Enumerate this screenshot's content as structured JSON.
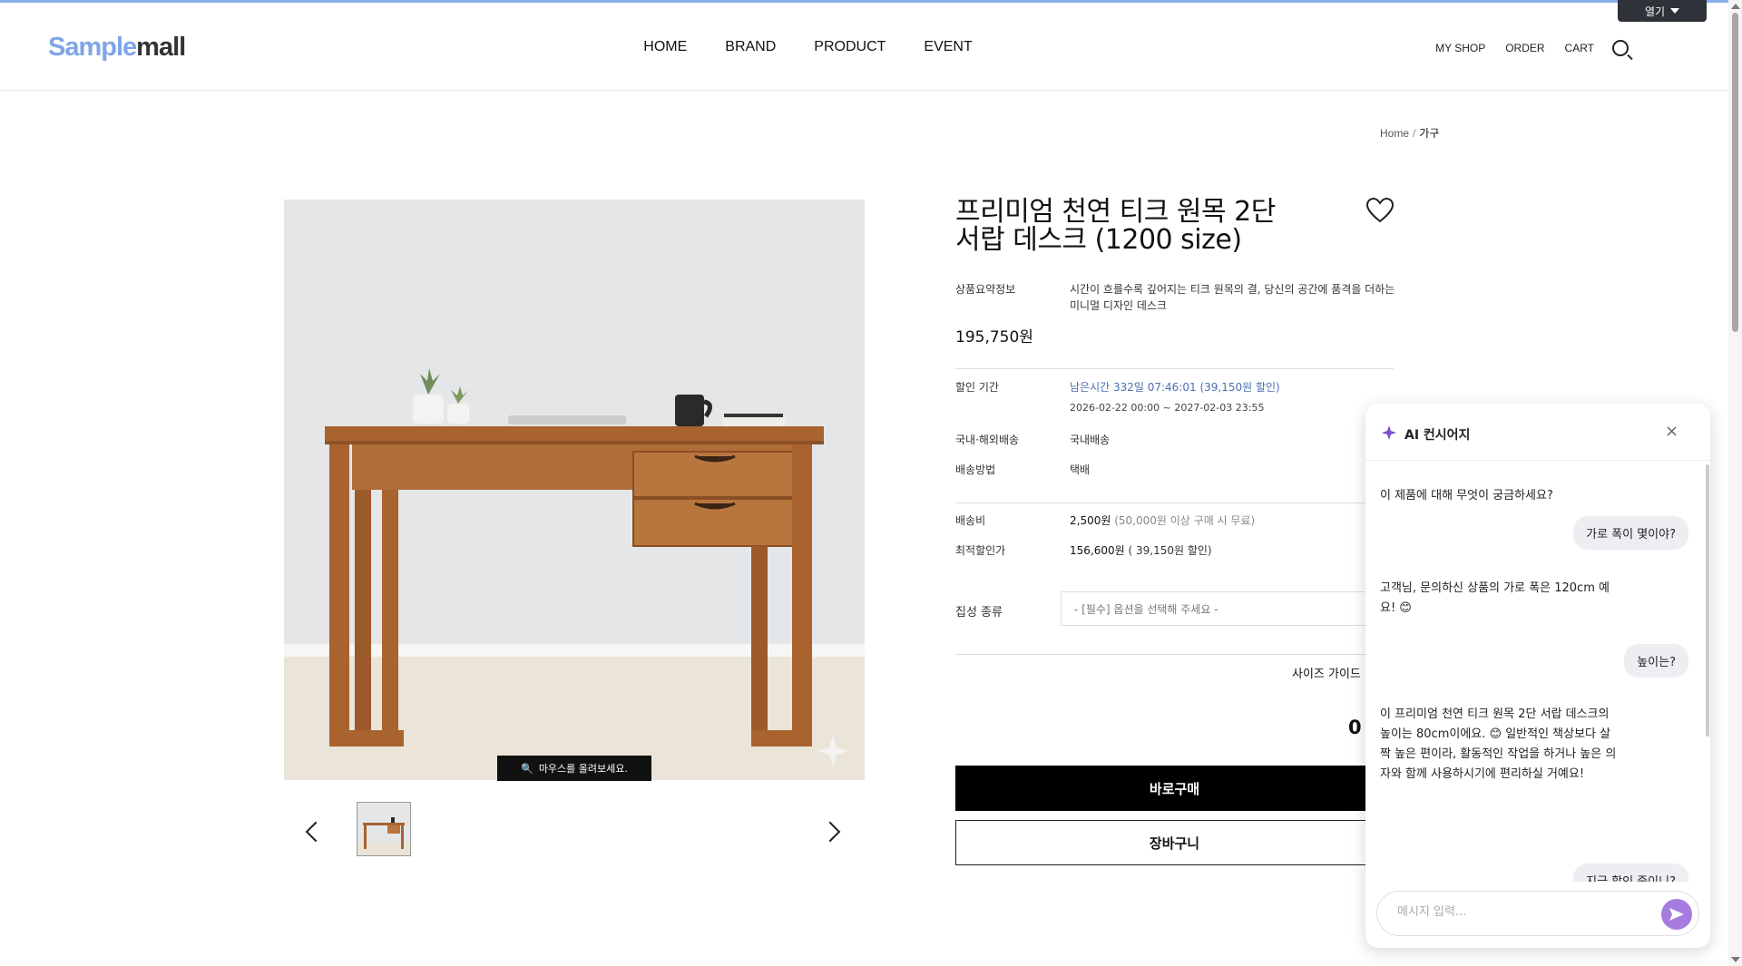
{
  "topbar": {
    "open_label": "열기"
  },
  "header": {
    "logo_part1": "Sample",
    "logo_part2": "mall",
    "nav": [
      "HOME",
      "BRAND",
      "PRODUCT",
      "EVENT"
    ],
    "util": [
      "MY SHOP",
      "ORDER",
      "CART"
    ]
  },
  "breadcrumb": {
    "home": "Home",
    "sep": "/",
    "current": "가구"
  },
  "gallery": {
    "zoom_hint": "마우스를 올려보세요."
  },
  "product": {
    "title": "프리미엄 천연 티크 원목 2단 서랍 데스크 (1200 size)",
    "summary_label": "상품요약정보",
    "summary": "시간이 흐를수록 깊어지는 티크 원목의 결, 당신의 공간에 품격을 더하는 미니멀 디자인 데스크",
    "price": "195,750원",
    "discount_label": "할인 기간",
    "discount_remaining": "남은시간 332일 07:46:01 (39,150원 할인)",
    "discount_period": "2026-02-22 00:00 ~ 2027-02-03 23:55",
    "ship_scope_label": "국내·해외배송",
    "ship_scope": "국내배송",
    "ship_method_label": "배송방법",
    "ship_method": "택배",
    "ship_fee_label": "배송비",
    "ship_fee": "2,500원",
    "ship_fee_note": "(50,000원 이상 구매 시 무료)",
    "best_price_label": "최적할인가",
    "best_price": "156,600원",
    "best_price_note": "( 39,150원 할인)",
    "option_label": "집성 종류",
    "option_placeholder": "- [필수] 옵션을 선택해 주세요 -",
    "size_guide": "사이즈 가이드",
    "total": "0",
    "buy_now": "바로구매",
    "cart": "장바구니"
  },
  "chat": {
    "title": "AI 컨시어지",
    "close": "×",
    "greeting": "이 제품에 대해 무엇이 궁금하세요?",
    "user1": "가로 폭이 몇이야?",
    "ai1": "고객님, 문의하신 상품의 가로 폭은 120cm 예요! 😊",
    "user2": "높이는?",
    "ai2": "이 프리미엄 천연 티크 원목 2단 서랍 데스크의 높이는 80cm이에요. 😊 일반적인 책상보다 살짝 높은 편이라, 활동적인 작업을 하거나 높은 의자와 함께 사용하시기에 편리하실 거예요!",
    "user3": "지금 할인 중이니?",
    "input_placeholder": "메시지 입력..."
  }
}
